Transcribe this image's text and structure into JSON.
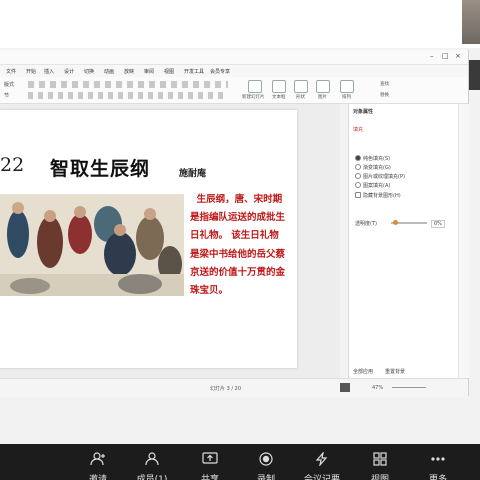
{
  "app": {
    "menu": [
      "文件",
      "开始",
      "插入",
      "设计",
      "切换",
      "动画",
      "放映",
      "审阅",
      "视图",
      "开发工具",
      "会员专享"
    ],
    "toolbar_labels": [
      "版式",
      "节",
      "新建幻灯片",
      "文本框",
      "形状",
      "图片",
      "排列",
      "查找",
      "替换"
    ],
    "pane_title": "对象属性",
    "pane_tab": "填充",
    "pane_options": [
      "纯色填充(S)",
      "渐变填充(G)",
      "图片或纹理填充(P)",
      "图案填充(A)",
      "隐藏背景图形(H)"
    ],
    "pane_transparency_label": "透明度(T)",
    "pane_transparency_value": "0%",
    "pane_reset": "全部应用",
    "pane_reset2": "重置背景",
    "status_left": "幻灯片 3 / 20",
    "status_zoom": "47%"
  },
  "slide": {
    "number": "22",
    "title": "智取生辰纲",
    "author": "施耐庵",
    "text": "  生辰纲，唐、宋时期是指编队运送的成批生日礼物。 该生日礼物是梁中书给他的岳父蔡京送的价值十万贯的金珠宝贝。"
  },
  "meeting": {
    "buttons": [
      "邀请",
      "成员(1)",
      "共享",
      "录制",
      "会议记要",
      "视图",
      "更多"
    ]
  },
  "colors": {
    "slide_text": "#c01818",
    "meeting_bar": "#1c1c1c"
  }
}
